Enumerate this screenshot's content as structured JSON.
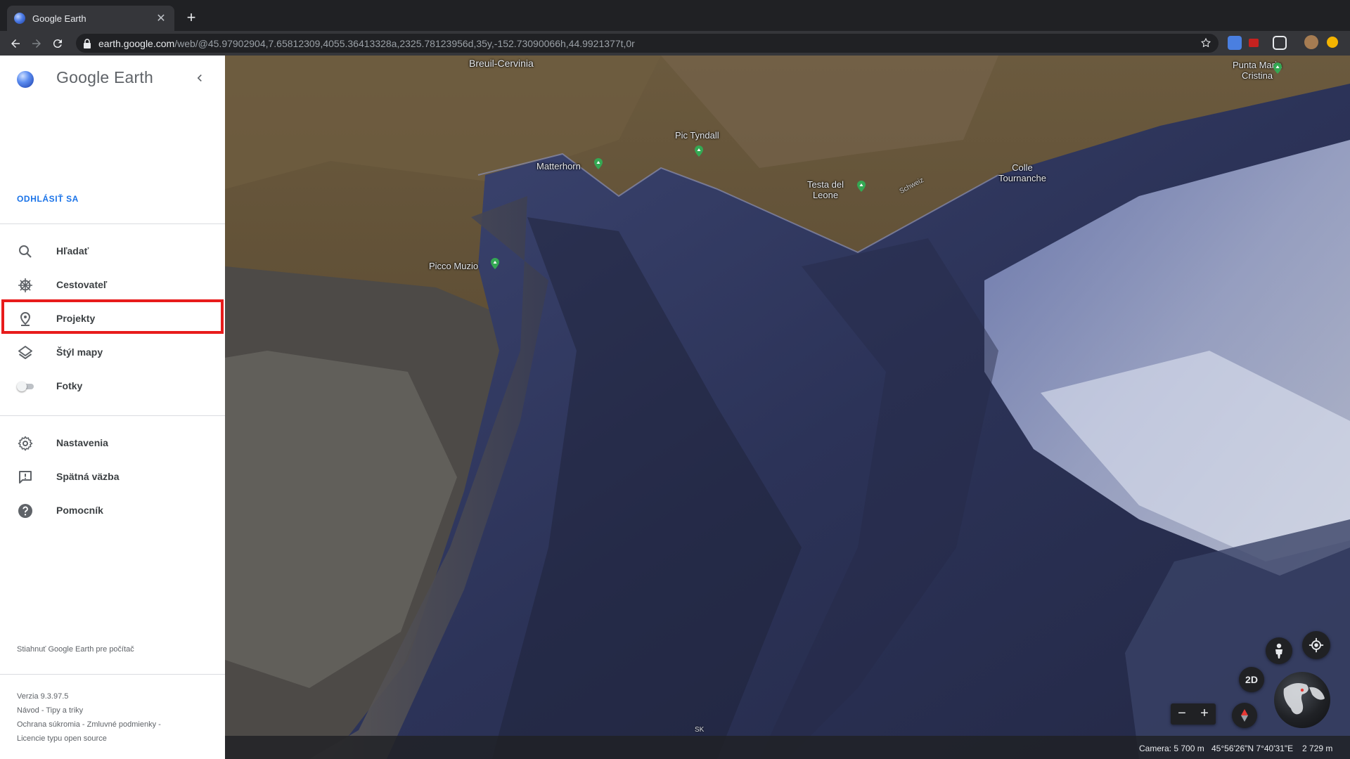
{
  "browser": {
    "tab_title": "Google Earth",
    "url_host": "earth.google.com",
    "url_path": "/web/@45.97902904,7.65812309,4055.36413328a,2325.78123956d,35y,-152.73090066h,44.9921377t,0r"
  },
  "sidebar": {
    "logo_text": "Google Earth",
    "signout_label": "ODHLÁSIŤ SA",
    "items": [
      {
        "label": "Hľadať",
        "icon": "search-icon"
      },
      {
        "label": "Cestovateľ",
        "icon": "ship-wheel-icon"
      },
      {
        "label": "Projekty",
        "icon": "map-pin-icon"
      },
      {
        "label": "Štýl mapy",
        "icon": "layers-icon"
      },
      {
        "label": "Fotky",
        "icon": "toggle-icon"
      },
      {
        "label": "Nastavenia",
        "icon": "gear-icon"
      },
      {
        "label": "Spätná väzba",
        "icon": "feedback-icon"
      },
      {
        "label": "Pomocník",
        "icon": "help-icon"
      }
    ],
    "download_label": "Stiahnuť Google Earth pre počítač",
    "footer": {
      "version": "Verzia 9.3.97.5",
      "line2": "Návod - Tipy a triky",
      "line3": "Ochrana súkromia - Zmluvné podmienky -",
      "line4": "Licencie typu open source"
    }
  },
  "map": {
    "places": [
      {
        "name": "Breuil-Cervinia"
      },
      {
        "name": "Punta Maria\nCristina"
      },
      {
        "name": "Pic Tyndall"
      },
      {
        "name": "Matterhorn"
      },
      {
        "name": "Testa del\nLeone"
      },
      {
        "name": "Colle\nTournanche"
      },
      {
        "name": "Picco Muzio"
      },
      {
        "name": "Schweiz"
      }
    ],
    "btn_2d": "2D",
    "zoom_out": "−",
    "zoom_in": "+",
    "language_code": "SK",
    "status": {
      "camera": "Camera: 5 700 m",
      "coords": "45°56'26\"N 7°40'31\"E",
      "elevation": "2 729 m"
    }
  },
  "colors": {
    "accent": "#1a73e8",
    "highlight": "#e81c1c",
    "pin": "#34a853"
  }
}
